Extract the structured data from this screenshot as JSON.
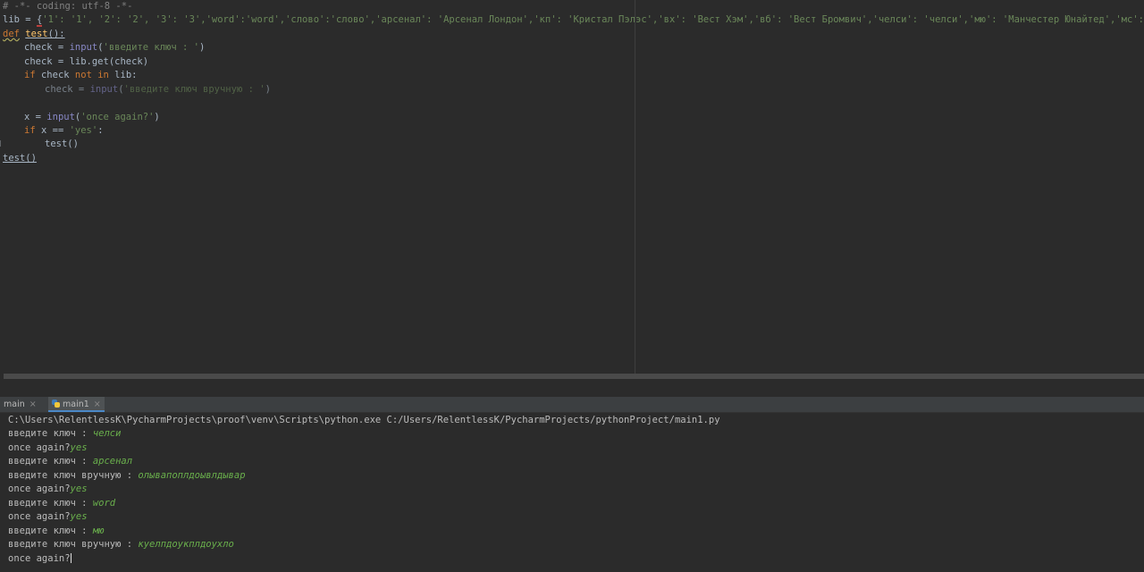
{
  "editor": {
    "line1": "# -*- coding: utf-8 -*-",
    "line2": {
      "lhs": "lib = ",
      "brace": "{",
      "body": "'1': '1', '2': '2', '3': '3','word':'word','слово':'слово','арсенал': 'Арсенал Лондон','кп': 'Кристал Пэлэс','вх': 'Вест Хэм','вб': 'Вест Бромвич','челси': 'челси','мю': 'Манчестер Юнайтед','мс': 'Манчес"
    },
    "line3": {
      "kw": "def",
      "name": "test",
      "rest": "():"
    },
    "line4": {
      "lhs": "check = ",
      "bi": "input",
      "open": "(",
      "str": "'введите ключ : '",
      "close": ")"
    },
    "line5": "check = lib.get(check)",
    "line6": {
      "kw1": "if",
      "mid": " check ",
      "kw2": "not in",
      "rest": " lib:"
    },
    "line7": {
      "lhs": "check = ",
      "bi": "input",
      "open": "(",
      "str": "'введите ключ вручную : '",
      "close": ")"
    },
    "line9": {
      "lhs": "x = ",
      "bi": "input",
      "open": "(",
      "str": "'once again?'",
      "close": ")"
    },
    "line10": {
      "kw": "if",
      "mid": " x == ",
      "str": "'yes'",
      "rest": ":"
    },
    "line11": "test()",
    "line12": "test()"
  },
  "tabs": [
    {
      "label": "main",
      "close": "×"
    },
    {
      "label": "main1",
      "close": "×"
    }
  ],
  "console": {
    "command": "C:\\Users\\RelentlessK\\PycharmProjects\\proof\\venv\\Scripts\\python.exe C:/Users/RelentlessK/PycharmProjects/pythonProject/main1.py",
    "lines": [
      {
        "prompt": "введите ключ : ",
        "input": "челси"
      },
      {
        "prompt": "once again?",
        "input": "yes"
      },
      {
        "prompt": "введите ключ : ",
        "input": "арсенал"
      },
      {
        "prompt": "введите ключ вручную : ",
        "input": "олывапоплдоывлдывар"
      },
      {
        "prompt": "once again?",
        "input": "yes"
      },
      {
        "prompt": "введите ключ : ",
        "input": "word"
      },
      {
        "prompt": "once again?",
        "input": "yes"
      },
      {
        "prompt": "введите ключ : ",
        "input": "мю"
      },
      {
        "prompt": "введите ключ вручную : ",
        "input": "куелпдоукплдоухло"
      },
      {
        "prompt": "once again?",
        "input": ""
      }
    ]
  },
  "colors": {
    "background": "#2b2b2b",
    "keyword": "#cc7832",
    "string": "#6a8759",
    "builtin": "#8888c6",
    "function": "#ffc66d",
    "console_input": "#6ab04c"
  }
}
